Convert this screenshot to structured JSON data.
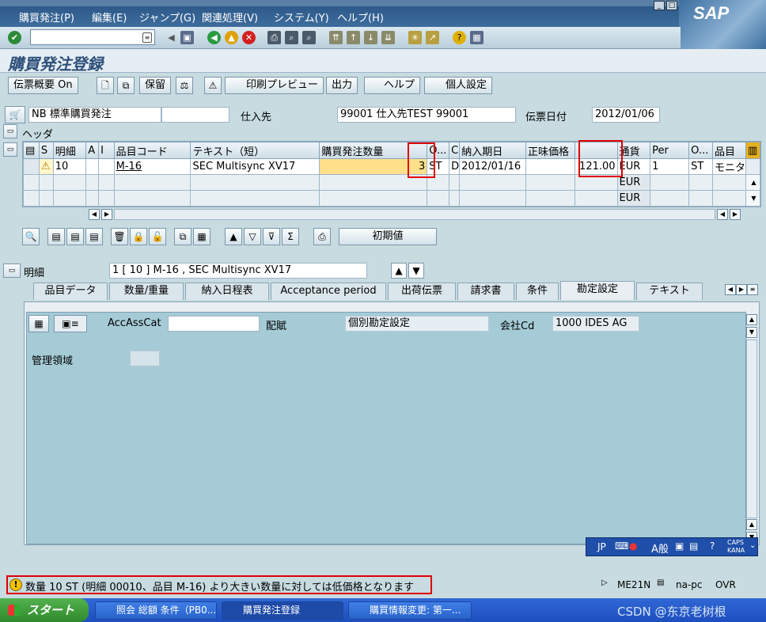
{
  "window": {
    "buttons": [
      "_",
      "□",
      "×"
    ]
  },
  "menu": [
    "購買発注(P)",
    "編集(E)",
    "ジャンプ(G)",
    "関連処理(V)",
    "システム(Y)",
    "ヘルプ(H)"
  ],
  "logo": "SAP",
  "command_field": {
    "value": ""
  },
  "title": "購買発注登録",
  "toolbar": {
    "doc_overview": "伝票概要 On",
    "hold": "保留",
    "print_preview": "印刷プレビュー",
    "output": "出力",
    "help": "ヘルプ",
    "personal": "個人設定"
  },
  "header": {
    "doc_type": "NB 標準購買発注",
    "vendor_label": "仕入先",
    "vendor_value": "99001 仕入先TEST 99001",
    "date_label": "伝票日付",
    "date_value": "2012/01/06",
    "section_label": "ヘッダ"
  },
  "items_table": {
    "columns": [
      "S",
      "明細",
      "A",
      "I",
      "品目コード",
      "テキスト（短）",
      "購買発注数量",
      "O...",
      "C",
      "納入期日",
      "正味価格",
      "",
      "通貨",
      "Per",
      "O...",
      "品目"
    ],
    "rows": [
      {
        "status": "⚠",
        "item": "10",
        "material": "M-16",
        "text": "SEC Multisync XV17",
        "qty": "3",
        "unit": "ST",
        "c": "D",
        "date": "2012/01/16",
        "net": "121.00",
        "currency": "EUR",
        "per": "1",
        "ounit": "ST",
        "group": "モニタ"
      },
      {
        "currency": "EUR"
      },
      {
        "currency": "EUR"
      }
    ]
  },
  "lower_toolbar": {
    "default_values": "初期値"
  },
  "detail": {
    "label": "明細",
    "selector": "1 [ 10 ] M-16 , SEC Multisync XV17"
  },
  "tabs": [
    "品目データ",
    "数量/重量",
    "納入日程表",
    "Acceptance period",
    "出荷伝票",
    "請求書",
    "条件",
    "勘定設定",
    "テキスト"
  ],
  "active_tab": "勘定設定",
  "account": {
    "acc_label": "AccAssCat",
    "acc_value": "",
    "dist_label": "配賦",
    "dist_value": "個別勘定設定",
    "company_label": "会社Cd",
    "company_value": "1000 IDES AG",
    "area_label": "管理領域",
    "area_value": ""
  },
  "ime": {
    "lang": "JP",
    "mode": "A般",
    "caps": "CAPS",
    "kana": "KANA"
  },
  "status": {
    "message": "数量 10 ST (明細 00010、品目 M-16) より大きい数量に対しては低価格となります",
    "tcode": "ME21N",
    "server": "na-pc",
    "mode": "OVR"
  },
  "taskbar": {
    "start": "スタート",
    "tasks": [
      "照会 総額 条件（PB0...",
      "購買発注登録",
      "購買情報変更: 第一..."
    ]
  },
  "watermark": "CSDN @东京老树根"
}
